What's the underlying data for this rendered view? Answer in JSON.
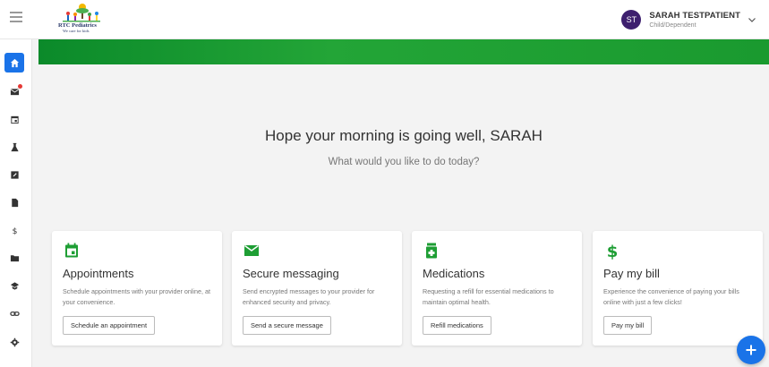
{
  "header": {
    "logo": {
      "name": "RTC Pediatrics",
      "tagline": "We care for kids"
    },
    "user": {
      "initials": "ST",
      "name": "SARAH TESTPATIENT",
      "role": "Child/Dependent"
    }
  },
  "sidebar": {
    "items": [
      {
        "icon": "home-icon",
        "active": true
      },
      {
        "icon": "mail-icon",
        "active": false,
        "notification": true
      },
      {
        "icon": "calendar-icon",
        "active": false
      },
      {
        "icon": "flask-icon",
        "active": false
      },
      {
        "icon": "edit-form-icon",
        "active": false
      },
      {
        "icon": "document-icon",
        "active": false
      },
      {
        "icon": "dollar-icon",
        "active": false
      },
      {
        "icon": "folder-icon",
        "active": false
      },
      {
        "icon": "education-icon",
        "active": false
      },
      {
        "icon": "link-icon",
        "active": false
      },
      {
        "icon": "gear-icon",
        "active": false
      }
    ]
  },
  "main": {
    "greeting": "Hope your morning is going well, SARAH",
    "subgreeting": "What would you like to do today?"
  },
  "cards": [
    {
      "icon": "calendar-icon",
      "title": "Appointments",
      "description": "Schedule appointments with your provider online, at your convenience.",
      "button": "Schedule an appointment"
    },
    {
      "icon": "mail-icon",
      "title": "Secure messaging",
      "description": "Send encrypted messages to your provider for enhanced security and privacy.",
      "button": "Send a secure message"
    },
    {
      "icon": "medication-icon",
      "title": "Medications",
      "description": "Requesting a refill for essential medications to maintain optimal health.",
      "button": "Refill medications"
    },
    {
      "icon": "dollar-icon",
      "title": "Pay my bill",
      "description": "Experience the convenience of paying your bills online with just a few clicks!",
      "button": "Pay my bill"
    }
  ],
  "colors": {
    "accent": "#1a73e8",
    "brand_green": "#1e9e34",
    "avatar": "#3d1f6e"
  }
}
